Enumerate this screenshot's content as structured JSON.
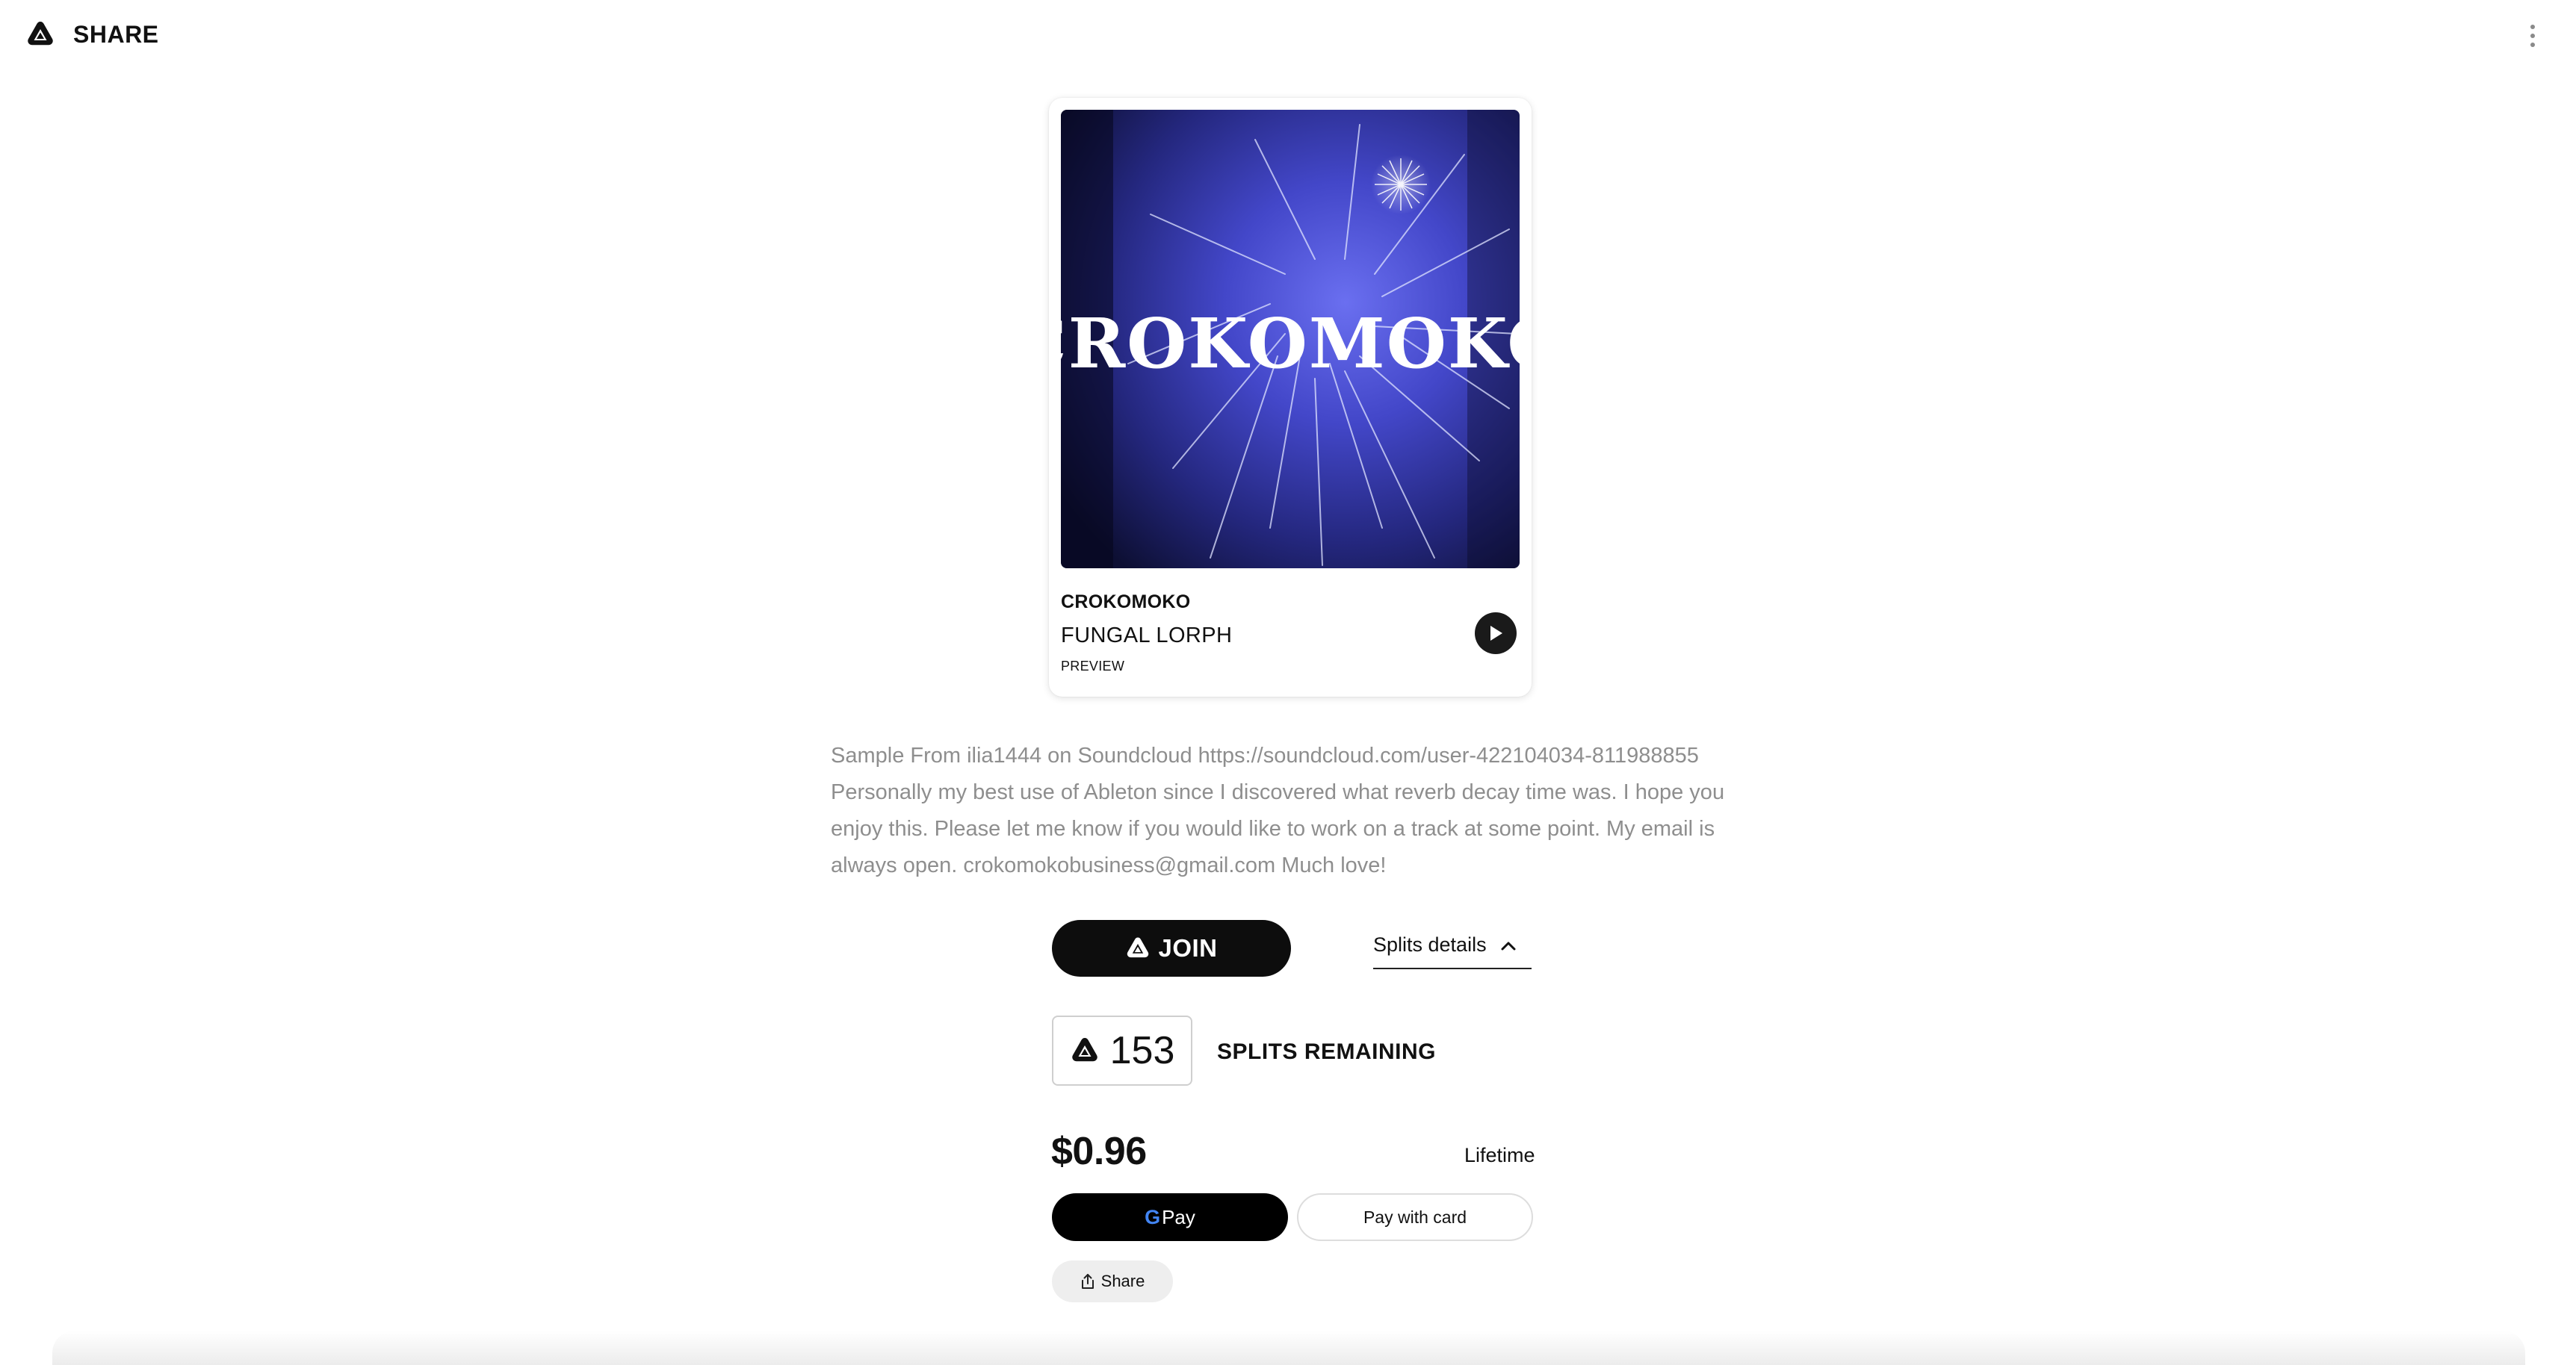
{
  "header": {
    "brand_name": "SHARE",
    "logo_icon": "share-logo-icon",
    "more_icon": "vertical-dots-icon"
  },
  "track": {
    "artwork_text": "CROKOMOKO",
    "artist": "CROKOMOKO",
    "title": "FUNGAL LORPH",
    "preview_label": "PREVIEW",
    "play_icon": "play-icon"
  },
  "description": "Sample From ilia1444 on Soundcloud https://soundcloud.com/user-422104034-811988855 Personally my best use of Ableton since I discovered what reverb decay time was. I hope you enjoy this. Please let me know if you would like to work on a track at some point. My email is always open. crokomokobusiness@gmail.com Much love!",
  "actions": {
    "join_label": "JOIN",
    "splits_details_label": "Splits details",
    "splits_details_icon": "chevron-up-icon"
  },
  "splits": {
    "count": "153",
    "remaining_label": "SPLITS REMAINING"
  },
  "pricing": {
    "price": "$0.96",
    "term": "Lifetime"
  },
  "payment": {
    "gpay_g": "G",
    "gpay_label": "Pay",
    "card_label": "Pay with card"
  },
  "share": {
    "label": "Share",
    "icon": "share-upload-icon"
  },
  "colors": {
    "artwork_deep": "#1b1e6e",
    "artwork_bright": "#5a5fe0",
    "button_dark": "#0d0d0d",
    "google_blue": "#4285f4"
  }
}
